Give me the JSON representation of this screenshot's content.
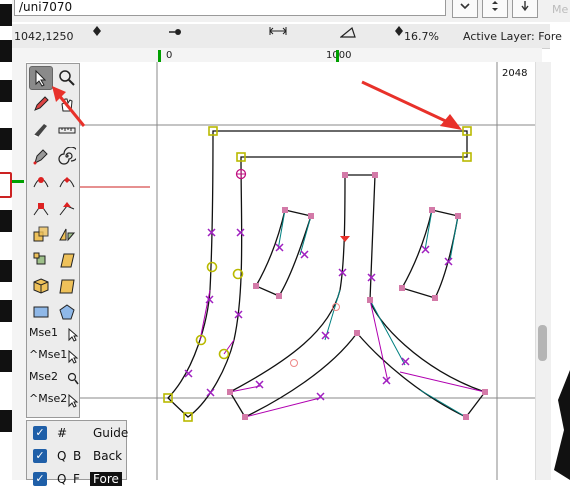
{
  "window": {
    "glyph_name": "/uni7070",
    "right_panel_label": "Me"
  },
  "info_bar": {
    "coordinates": "1042,1250",
    "zoom": "16.7%",
    "active_layer": "Active Layer: Fore"
  },
  "ruler": {
    "labels": [
      "0",
      "1000"
    ],
    "right_value": "2048"
  },
  "tools": {
    "items": [
      "pointer-tool",
      "magnify-tool",
      "freehand-tool",
      "scroll-tool",
      "knife-tool",
      "ruler-tool",
      "pen-tool",
      "spiro-tool",
      "curve-point-tool",
      "corner-point-tool",
      "tangent-point-tool",
      "hv-curve-tool",
      "scale-tool",
      "flip-tool",
      "rotate-tool",
      "skew-tool",
      "3d-rotate-tool",
      "perspective-tool",
      "rectangle-tool",
      "polygon-tool"
    ],
    "mouse_bindings": [
      {
        "label": "Mse1",
        "icon": "arrow-icon"
      },
      {
        "label": "^Mse1",
        "icon": "arrow-icon"
      },
      {
        "label": "Mse2",
        "icon": "magnify-icon"
      },
      {
        "label": "^Mse2",
        "icon": "arrow-icon"
      }
    ]
  },
  "layers": [
    {
      "checked": true,
      "sym1": "#",
      "sym2": "",
      "name": "Guide"
    },
    {
      "checked": true,
      "sym1": "Q",
      "sym2": "B",
      "name": "Back"
    },
    {
      "checked": true,
      "sym1": "Q",
      "sym2": "F",
      "name": "Fore"
    }
  ],
  "colors": {
    "outline": "#111111",
    "control_point": "#cc66aa",
    "handle": "#008080",
    "off_curve": "#b000b0",
    "selected_point": "#c0c000",
    "arrow_annotation": "#e8312a",
    "guide_line": "#888888",
    "ruler_marker": "#00a000"
  }
}
